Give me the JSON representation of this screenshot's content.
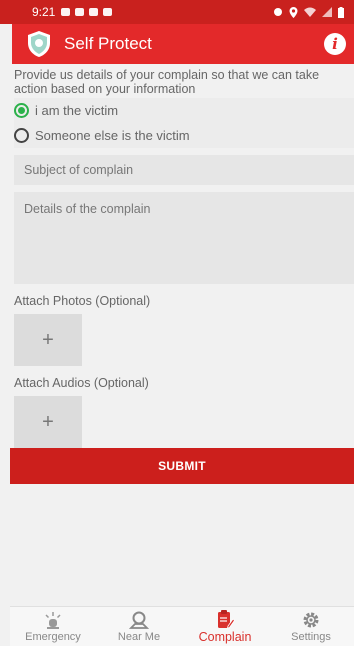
{
  "status_bar": {
    "time": "9:21"
  },
  "app_bar": {
    "title": "Self Protect"
  },
  "form": {
    "description": "Provide us details of your complain so that we can take action based on your information",
    "radio_options": [
      {
        "label": "i am the victim",
        "selected": true
      },
      {
        "label": "Someone else is the victim",
        "selected": false
      }
    ],
    "subject_placeholder": "Subject of complain",
    "details_placeholder": "Details of the complain",
    "photos_label": "Attach Photos (Optional)",
    "audios_label": "Attach Audios (Optional)",
    "add_symbol": "+",
    "submit_label": "SUBMIT"
  },
  "bottom_nav": {
    "items": [
      {
        "label": "Emergency",
        "icon": "siren-icon",
        "active": false
      },
      {
        "label": "Near Me",
        "icon": "map-pin-icon",
        "active": false
      },
      {
        "label": "Complain",
        "icon": "clipboard-edit-icon",
        "active": true
      },
      {
        "label": "Settings",
        "icon": "gear-icon",
        "active": false
      }
    ]
  },
  "colors": {
    "primary": "#e3292a",
    "status_bar": "#c9211e",
    "submit": "#cc1f1c",
    "radio_selected": "#2bb14a",
    "active_nav": "#d9302c"
  }
}
